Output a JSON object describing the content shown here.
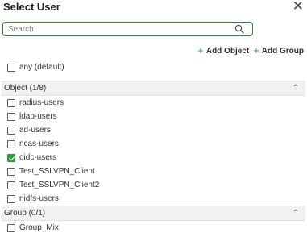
{
  "dialog": {
    "title": "Select User",
    "close_glyph": "✕"
  },
  "search": {
    "placeholder": "Search",
    "value": ""
  },
  "actions": {
    "add_object": "Add Object",
    "add_group": "Add Group",
    "plus": "+"
  },
  "any": {
    "label": "any (default)",
    "checked": false
  },
  "object_group": {
    "title": "Object (1/8)",
    "items": [
      {
        "label": "radius-users",
        "checked": false
      },
      {
        "label": "ldap-users",
        "checked": false
      },
      {
        "label": "ad-users",
        "checked": false
      },
      {
        "label": "ncas-users",
        "checked": false
      },
      {
        "label": "oidc-users",
        "checked": true
      },
      {
        "label": "Test_SSLVPN_Client",
        "checked": false
      },
      {
        "label": "Test_SSLVPN_Client2",
        "checked": false
      },
      {
        "label": "nidfs-users",
        "checked": false
      }
    ]
  },
  "group_group": {
    "title": "Group (0/1)",
    "items": [
      {
        "label": "Group_Mix",
        "checked": false
      }
    ]
  },
  "colors": {
    "accent_green": "#2e9a35",
    "search_border": "#2f8a2f",
    "group_header_bg": "#f1f1f1"
  },
  "icons": {
    "close": "close-icon",
    "search": "search-icon",
    "collapse": "chevron-up-icon",
    "plus": "plus-icon"
  }
}
